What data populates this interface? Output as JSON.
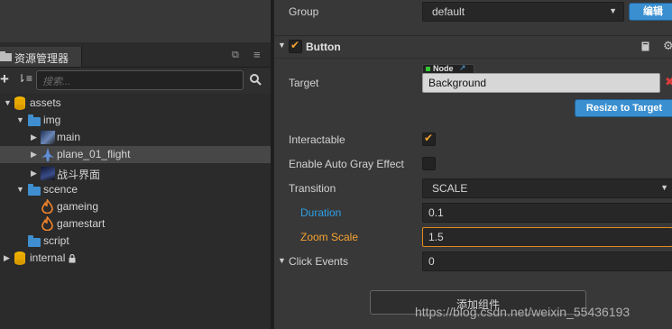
{
  "assets_panel": {
    "tab_title": "资源管理器",
    "search_placeholder": "搜索...",
    "tree": [
      {
        "label": "assets"
      },
      {
        "label": "img"
      },
      {
        "label": "main"
      },
      {
        "label": "plane_01_flight"
      },
      {
        "label": "战斗界面"
      },
      {
        "label": "scence"
      },
      {
        "label": "gameing"
      },
      {
        "label": "gamestart"
      },
      {
        "label": "script"
      },
      {
        "label": "internal"
      }
    ]
  },
  "inspector": {
    "group": {
      "label": "Group",
      "value": "default",
      "edit_button": "编辑"
    },
    "component": {
      "title": "Button",
      "enabled": true
    },
    "target": {
      "label": "Target",
      "type_tag": "Node",
      "value": "Background"
    },
    "resize_button": "Resize to Target",
    "interactable": {
      "label": "Interactable",
      "checked": true
    },
    "auto_gray": {
      "label": "Enable Auto Gray Effect",
      "checked": false
    },
    "transition": {
      "label": "Transition",
      "value": "SCALE"
    },
    "duration": {
      "label": "Duration",
      "value": "0.1"
    },
    "zoom_scale": {
      "label": "Zoom Scale",
      "value": "1.5"
    },
    "click_events": {
      "label": "Click Events",
      "value": "0"
    },
    "add_component_button": "添加组件"
  },
  "watermark": "https://blog.csdn.net/weixin_55436193",
  "colors": {
    "accent_blue": "#3a8fd0",
    "checkbox_orange": "#f5a231",
    "label_blue": "#2da0e6",
    "label_orange": "#f5a231"
  }
}
